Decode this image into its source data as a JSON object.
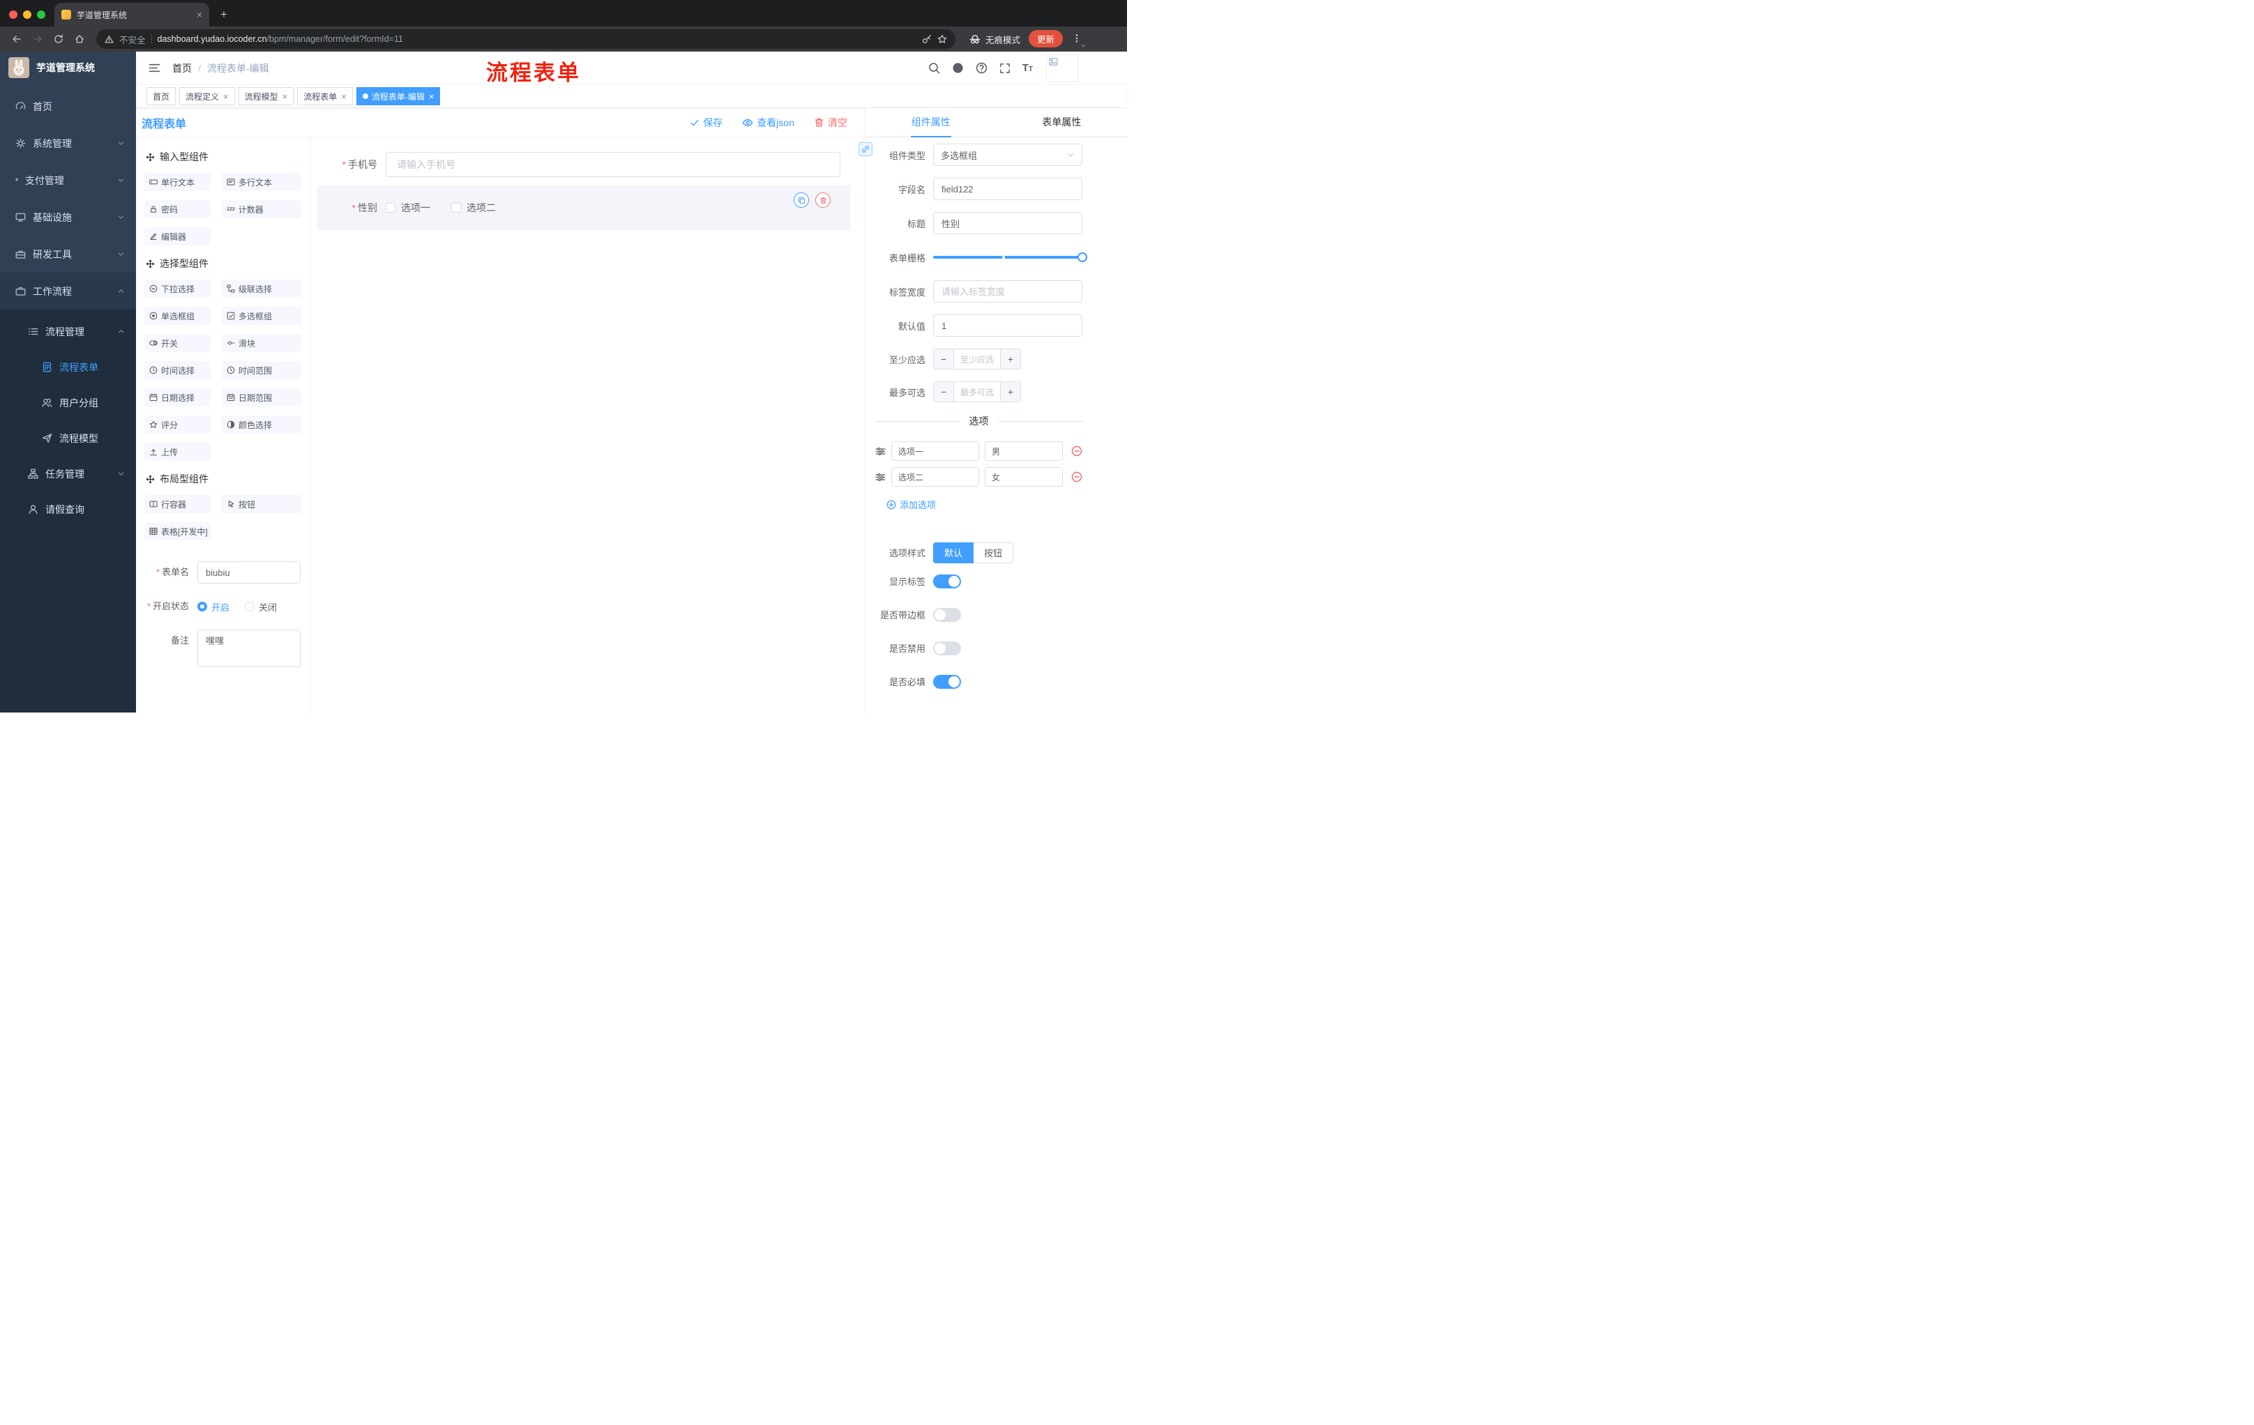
{
  "colors": {
    "accent": "#409eff",
    "danger": "#f56c6c",
    "annotation_red": "#f2220e",
    "update_chip": "#e2513e",
    "sidebar_bg": "#304156",
    "sidebar_submenu_bg": "#1f2d3d"
  },
  "browser": {
    "tab_title": "芋道管理系统",
    "security_label": "不安全",
    "url_host": "dashboard.yudao.iocoder.cn",
    "url_path": "/bpm/manager/form/edit?formId=11",
    "incognito_label": "无痕模式",
    "update_label": "更新"
  },
  "sidebar": {
    "logo_title": "芋道管理系统",
    "menu": [
      {
        "name": "home",
        "label": "首页",
        "icon": "dashboard-icon"
      },
      {
        "name": "system-management",
        "label": "系统管理",
        "icon": "gear-icon",
        "chevron": "down"
      },
      {
        "name": "payment-management",
        "label": "支付管理",
        "icon": "yen-icon",
        "chevron": "down"
      },
      {
        "name": "infrastructure",
        "label": "基础设施",
        "icon": "infra-icon",
        "chevron": "down"
      },
      {
        "name": "dev-tools",
        "label": "研发工具",
        "icon": "tools-icon",
        "chevron": "down"
      },
      {
        "name": "workflow",
        "label": "工作流程",
        "icon": "workflow-icon",
        "chevron": "up",
        "open": true
      }
    ],
    "submenu": [
      {
        "name": "process-management",
        "label": "流程管理",
        "icon": "list-icon",
        "level": 2,
        "chevron": "up"
      },
      {
        "name": "process-form",
        "label": "流程表单",
        "icon": "doc-icon",
        "level": 3,
        "active": true
      },
      {
        "name": "user-group",
        "label": "用户分组",
        "icon": "users-icon",
        "level": 3
      },
      {
        "name": "process-model",
        "label": "流程模型",
        "icon": "send-icon",
        "level": 3
      },
      {
        "name": "task-management",
        "label": "任务管理",
        "icon": "tree-icon",
        "level": 2,
        "chevron": "down"
      },
      {
        "name": "leave-query",
        "label": "请假查询",
        "icon": "person-icon",
        "level": 2
      }
    ]
  },
  "header": {
    "breadcrumb": [
      "首页",
      "流程表单-编辑"
    ],
    "annotation": "流程表单"
  },
  "tags": [
    {
      "name": "home",
      "label": "首页",
      "closable": false,
      "active": false
    },
    {
      "name": "process-definition",
      "label": "流程定义",
      "closable": true,
      "active": false
    },
    {
      "name": "process-model",
      "label": "流程模型",
      "closable": true,
      "active": false
    },
    {
      "name": "process-form",
      "label": "流程表单",
      "closable": true,
      "active": false
    },
    {
      "name": "process-form-edit",
      "label": "流程表单-编辑",
      "closable": true,
      "active": true
    }
  ],
  "work": {
    "title": "流程表单",
    "save_label": "保存",
    "view_json_label": "查看json",
    "clear_label": "清空"
  },
  "palette": {
    "sections": [
      {
        "title": "输入型组件",
        "items": [
          {
            "name": "single-line-text",
            "label": "单行文本",
            "icon": "input-icon"
          },
          {
            "name": "multi-line-text",
            "label": "多行文本",
            "icon": "textarea-icon"
          },
          {
            "name": "password",
            "label": "密码",
            "icon": "lock-icon"
          },
          {
            "name": "counter",
            "label": "计数器",
            "icon": "counter-icon"
          },
          {
            "name": "editor",
            "label": "编辑器",
            "icon": "editor-icon"
          }
        ]
      },
      {
        "title": "选择型组件",
        "items": [
          {
            "name": "select",
            "label": "下拉选择",
            "icon": "select-icon"
          },
          {
            "name": "cascader",
            "label": "级联选择",
            "icon": "cascader-icon"
          },
          {
            "name": "radio-group",
            "label": "单选框组",
            "icon": "radio-icon"
          },
          {
            "name": "checkbox-group",
            "label": "多选框组",
            "icon": "checkbox-icon"
          },
          {
            "name": "switch",
            "label": "开关",
            "icon": "switch-icon"
          },
          {
            "name": "slider",
            "label": "滑块",
            "icon": "slider-icon"
          },
          {
            "name": "time-picker",
            "label": "时间选择",
            "icon": "time-icon"
          },
          {
            "name": "time-range",
            "label": "时间范围",
            "icon": "time-range-icon"
          },
          {
            "name": "date-picker",
            "label": "日期选择",
            "icon": "date-icon"
          },
          {
            "name": "date-range",
            "label": "日期范围",
            "icon": "date-range-icon"
          },
          {
            "name": "rate",
            "label": "评分",
            "icon": "star-icon"
          },
          {
            "name": "color-picker",
            "label": "颜色选择",
            "icon": "color-icon"
          },
          {
            "name": "upload",
            "label": "上传",
            "icon": "upload-icon"
          }
        ]
      },
      {
        "title": "布局型组件",
        "items": [
          {
            "name": "row-container",
            "label": "行容器",
            "icon": "row-icon"
          },
          {
            "name": "button",
            "label": "按钮",
            "icon": "button-icon"
          },
          {
            "name": "table",
            "label": "表格[开发中]",
            "icon": "table-icon"
          }
        ]
      }
    ],
    "form": {
      "name_label": "表单名",
      "name_value": "biubiu",
      "status_label": "开启状态",
      "status_on": "开启",
      "status_off": "关闭",
      "remark_label": "备注",
      "remark_value": "嘿嘿"
    }
  },
  "canvas": {
    "fields": [
      {
        "label": "手机号",
        "required": true,
        "placeholder": "请输入手机号"
      },
      {
        "label": "性别",
        "required": true,
        "options": [
          "选项一",
          "选项二"
        ]
      }
    ]
  },
  "props": {
    "tabs": [
      "组件属性",
      "表单属性"
    ],
    "rows": {
      "component_type": {
        "label": "组件类型",
        "value": "多选框组"
      },
      "field_name": {
        "label": "字段名",
        "value": "field122"
      },
      "title": {
        "label": "标题",
        "value": "性别"
      },
      "grid": {
        "label": "表单栅格"
      },
      "label_width": {
        "label": "标签宽度",
        "placeholder": "请输入标签宽度"
      },
      "default_value": {
        "label": "默认值",
        "value": "1"
      },
      "min_select": {
        "label": "至少应选",
        "placeholder": "至少应选"
      },
      "max_select": {
        "label": "最多可选",
        "placeholder": "最多可选"
      }
    },
    "options": {
      "divider_label": "选项",
      "rows": [
        {
          "label": "选项一",
          "value": "男"
        },
        {
          "label": "选项二",
          "value": "女"
        }
      ],
      "add_label": "添加选项"
    },
    "style": {
      "label": "选项样式",
      "buttons": [
        "默认",
        "按钮"
      ],
      "active": "默认"
    },
    "switches": [
      {
        "name": "show-label",
        "label": "显示标签",
        "on": true
      },
      {
        "name": "with-border",
        "label": "是否带边框",
        "on": false
      },
      {
        "name": "disabled",
        "label": "是否禁用",
        "on": false
      },
      {
        "name": "required",
        "label": "是否必填",
        "on": true
      }
    ]
  }
}
